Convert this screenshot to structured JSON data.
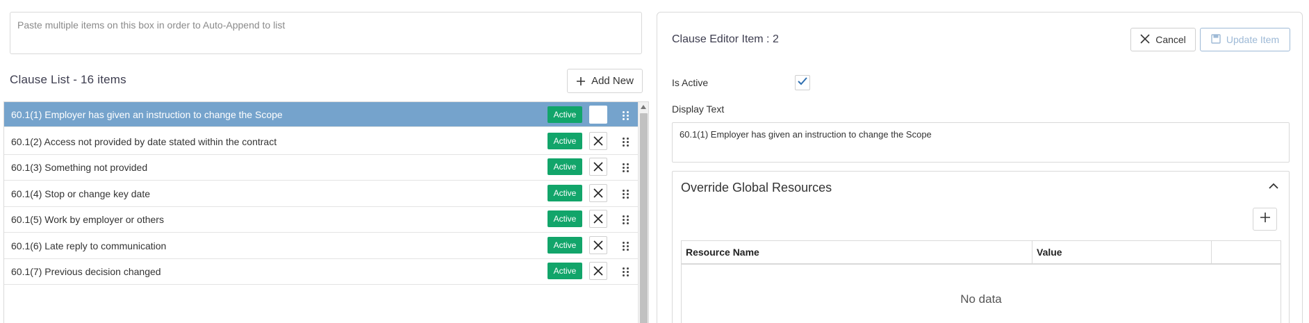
{
  "paste_box": {
    "placeholder": "Paste multiple items on this box in order to Auto-Append to list"
  },
  "clause_list": {
    "title": "Clause List - 16 items",
    "add_new_label": "Add New",
    "items": [
      {
        "text": "60.1(1) Employer has given an instruction to change the Scope",
        "status": "Active",
        "selected": true
      },
      {
        "text": "60.1(2) Access not provided by date stated within the contract",
        "status": "Active",
        "selected": false
      },
      {
        "text": "60.1(3) Something not provided",
        "status": "Active",
        "selected": false
      },
      {
        "text": "60.1(4) Stop or change key date",
        "status": "Active",
        "selected": false
      },
      {
        "text": "60.1(5) Work by employer or others",
        "status": "Active",
        "selected": false
      },
      {
        "text": "60.1(6) Late reply to communication",
        "status": "Active",
        "selected": false
      },
      {
        "text": "60.1(7) Previous decision changed",
        "status": "Active",
        "selected": false
      }
    ]
  },
  "editor": {
    "title": "Clause Editor Item : 2",
    "cancel_label": "Cancel",
    "update_label": "Update Item",
    "is_active_label": "Is Active",
    "is_active": true,
    "display_text_label": "Display Text",
    "display_text_value": "60.1(1) Employer has given an instruction to change the Scope",
    "override": {
      "title": "Override Global Resources",
      "columns": [
        "Resource Name",
        "Value",
        ""
      ],
      "empty_text": "No data"
    }
  },
  "colors": {
    "selected_row": "#75a3cc",
    "active_badge": "#12a56a",
    "update_button": "#9db9d6",
    "checkmark": "#2f6fb0"
  }
}
